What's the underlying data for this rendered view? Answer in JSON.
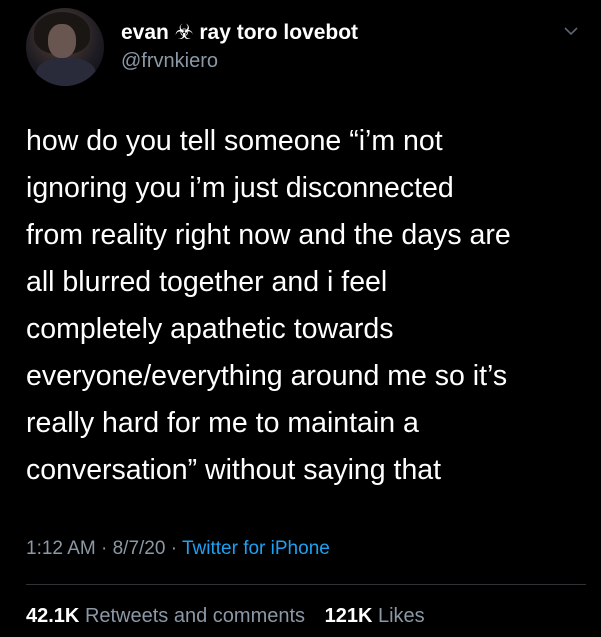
{
  "tweet": {
    "display_name": "evan ☣ ray toro lovebot",
    "handle": "@frvnkiero",
    "text": "how do you tell someone “i’m not\nignoring you i’m just disconnected\nfrom reality right now and the days are\nall blurred together and i feel\ncompletely apathetic towards\neveryone/everything around me so it’s\nreally hard for me to maintain a\nconversation” without saying that",
    "time": "1:12 AM",
    "date": "8/7/20",
    "separator": "·",
    "source": "Twitter for iPhone",
    "retweets_count": "42.1K",
    "retweets_label": "Retweets and comments",
    "likes_count": "121K",
    "likes_label": "Likes"
  },
  "icons": {
    "more": "chevron-down-icon",
    "avatar": "avatar"
  },
  "colors": {
    "background": "#000000",
    "text": "#ffffff",
    "muted": "#8b98a5",
    "link": "#1da1f2"
  }
}
